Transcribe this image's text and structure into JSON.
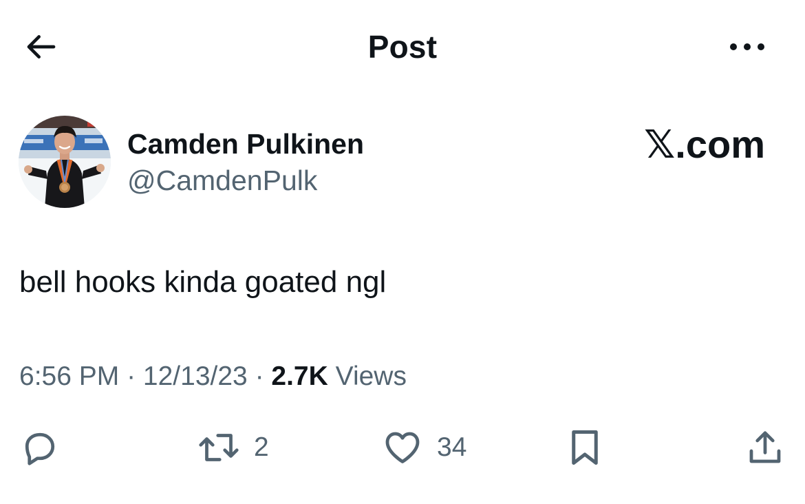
{
  "header": {
    "title": "Post",
    "back_icon": "arrow-left-icon",
    "more_icon": "more-horizontal-icon"
  },
  "author": {
    "display_name": "Camden Pulkinen",
    "handle": "@CamdenPulk",
    "avatar": "avatar-photo"
  },
  "watermark": "𝕏.com",
  "post": {
    "text": "bell hooks kinda goated ngl"
  },
  "meta": {
    "time": "6:56 PM",
    "sep1": " · ",
    "date": "12/13/23",
    "sep2": " · ",
    "views_count": "2.7K",
    "views_label": " Views"
  },
  "actions": {
    "reply": {
      "icon": "reply-icon"
    },
    "repost": {
      "icon": "repost-icon",
      "count": "2"
    },
    "like": {
      "icon": "heart-icon",
      "count": "34"
    },
    "bookmark": {
      "icon": "bookmark-icon"
    },
    "share": {
      "icon": "share-icon"
    }
  },
  "colors": {
    "text_primary": "#0f1419",
    "text_secondary": "#536471",
    "background": "#ffffff"
  }
}
